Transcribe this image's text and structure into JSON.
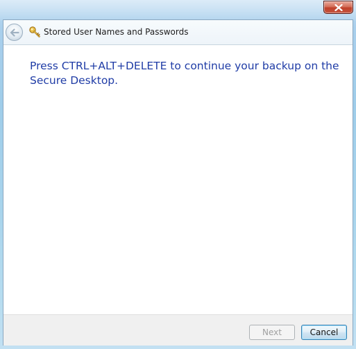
{
  "window": {
    "title": "Stored User Names and Passwords",
    "close_icon": "close-icon",
    "back_icon": "back-arrow-icon",
    "title_icon": "key-icon"
  },
  "content": {
    "message": "Press CTRL+ALT+DELETE to continue your backup on the Secure Desktop."
  },
  "footer": {
    "next_label": "Next",
    "next_enabled": false,
    "cancel_label": "Cancel"
  },
  "colors": {
    "message_text": "#1f3ca6",
    "close_button_red": "#c0402a"
  }
}
